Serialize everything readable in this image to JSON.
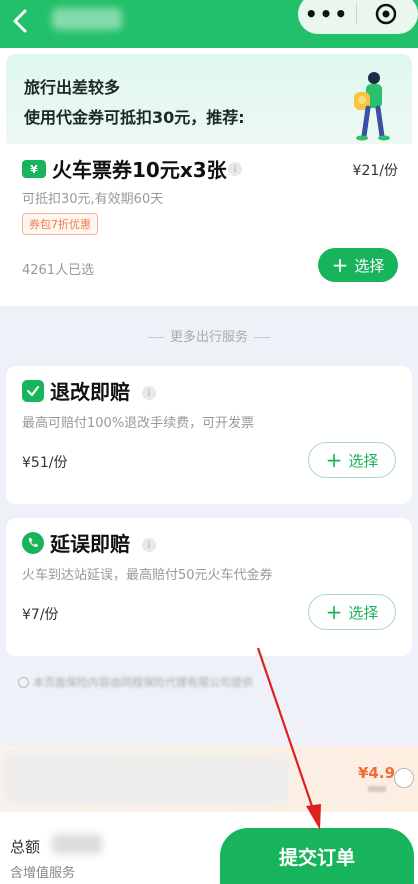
{
  "promo": {
    "line1": "旅行出差较多",
    "line2": "使用代金券可抵扣30元，推荐:",
    "ticket_title": "火车票券10元x3张",
    "ticket_icon_text": "¥",
    "ticket_price": "¥21/份",
    "ticket_sub": "可抵扣30元,有效期60天",
    "coupon_tag": "券包7折优惠",
    "chosen_count": "4261人已选",
    "select_label": "选择"
  },
  "divider": "更多出行服务",
  "services": [
    {
      "title": "退改即赔",
      "desc": "最高可赔付100%退改手续费，可开发票",
      "price": "¥51/份",
      "select_label": "选择"
    },
    {
      "title": "延误即赔",
      "desc": "火车到达站延误，最高赔付50元火车代金券",
      "price": "¥7/份",
      "select_label": "选择"
    }
  ],
  "disclaimer": "本页面保险内容由同程保险代理有限公司提供",
  "strip": {
    "price": "¥4.9"
  },
  "footer": {
    "total_label": "总额",
    "vat_label": "含增值服务",
    "submit_label": "提交订单"
  },
  "colors": {
    "brand": "#18b45b",
    "header": "#22c06a",
    "accent_orange": "#f36b3a",
    "annotation_arrow": "#e02020"
  }
}
